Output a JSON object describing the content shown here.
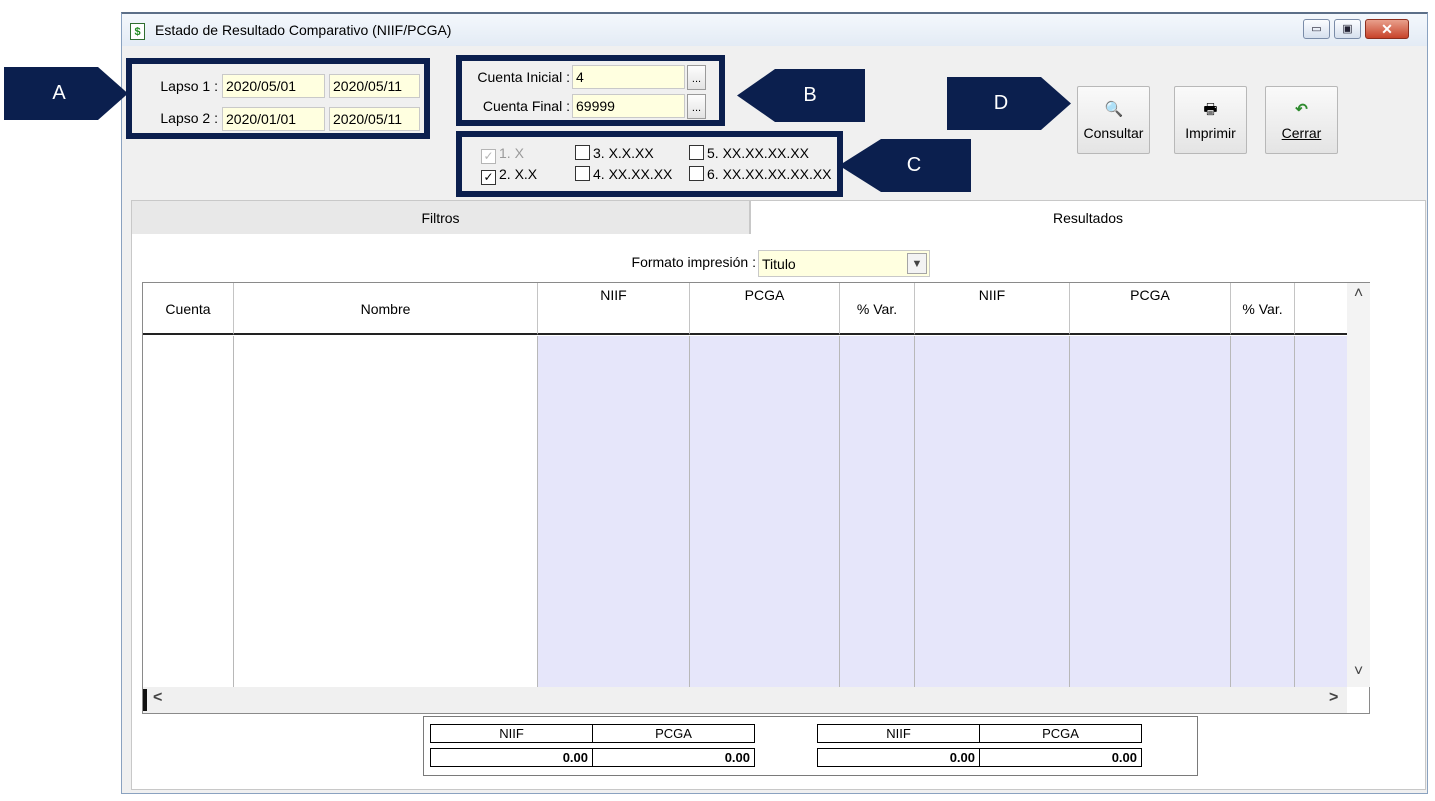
{
  "window": {
    "title": "Estado de Resultado Comparativo (NIIF/PCGA)",
    "icon": "dollar-document-icon",
    "controls": {
      "minimize": "▭",
      "maximize": "▣",
      "close": "✕"
    }
  },
  "lapsos": {
    "lapso1": {
      "label": "Lapso 1 :",
      "from": "2020/05/01",
      "to": "2020/05/11"
    },
    "lapso2": {
      "label": "Lapso 2 :",
      "from": "2020/01/01",
      "to": "2020/05/11"
    }
  },
  "cuentas": {
    "inicial": {
      "label": "Cuenta Inicial :",
      "value": "4",
      "button": "..."
    },
    "final": {
      "label": "Cuenta Final :",
      "value": "69999",
      "button": "..."
    }
  },
  "niveles": [
    {
      "label": "1. X",
      "checked": true,
      "enabled": false
    },
    {
      "label": "2. X.X",
      "checked": true,
      "enabled": true
    },
    {
      "label": "3. X.X.XX",
      "checked": false,
      "enabled": true
    },
    {
      "label": "4. XX.XX.XX",
      "checked": false,
      "enabled": true
    },
    {
      "label": "5. XX.XX.XX.XX",
      "checked": false,
      "enabled": true
    },
    {
      "label": "6. XX.XX.XX.XX.XX",
      "checked": false,
      "enabled": true
    }
  ],
  "toolbar": {
    "consultar": {
      "label": "Consultar",
      "icon": "magnifier-document-icon"
    },
    "imprimir": {
      "label": "Imprimir",
      "icon": "printer-icon"
    },
    "cerrar": {
      "label": "Cerrar",
      "icon": "undo-arrow-icon",
      "accent": "#2e8b2e"
    }
  },
  "tabs": [
    {
      "label": "Filtros",
      "active": false
    },
    {
      "label": "Resultados",
      "active": true
    }
  ],
  "formato": {
    "label": "Formato impresión :",
    "value": "Titulo"
  },
  "grid": {
    "columns": [
      "Cuenta",
      "Nombre",
      "NIIF",
      "PCGA",
      "% Var.",
      "NIIF",
      "PCGA",
      "% Var."
    ],
    "rows": [],
    "shade_color": "#e6e6fa",
    "scroll_up": "˄",
    "scroll_down": "˅",
    "scroll_left": "<",
    "scroll_right": ">"
  },
  "totals": {
    "group1": {
      "niif_label": "NIIF",
      "pcga_label": "PCGA",
      "niif": "0.00",
      "pcga": "0.00"
    },
    "group2": {
      "niif_label": "NIIF",
      "pcga_label": "PCGA",
      "niif": "0.00",
      "pcga": "0.00"
    }
  },
  "callouts": {
    "a": "A",
    "b": "B",
    "c": "C",
    "d": "D",
    "color": "#0b1f4e"
  }
}
